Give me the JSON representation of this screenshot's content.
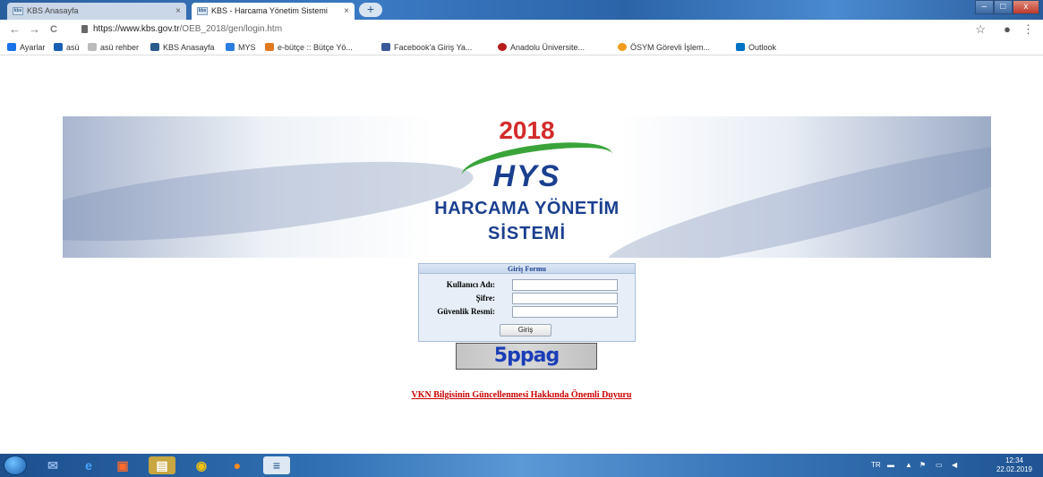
{
  "browser": {
    "tabs": [
      {
        "label": "KBS Anasayfa",
        "active": false
      },
      {
        "label": "KBS - Harcama Yönetim Sistemi",
        "active": true
      }
    ],
    "tab_close": "×",
    "new_tab": "+",
    "window_controls": {
      "minimize": "–",
      "maximize": "□",
      "close": "x"
    },
    "nav": {
      "back": "←",
      "forward": "→",
      "reload": "C"
    },
    "url_host": "https://www.kbs.gov.tr",
    "url_path": "/OEB_2018/gen/login.htm",
    "bookmarks": [
      {
        "label": "Ayarlar",
        "color": "#1a73e8"
      },
      {
        "label": "asü",
        "color": "#1a5fb4"
      },
      {
        "label": "asü rehber",
        "color": "#888888"
      },
      {
        "label": "KBS Anasayfa",
        "color": "#2a5a8c"
      },
      {
        "label": "MYS",
        "color": "#2a7de1"
      },
      {
        "label": "e-bütçe :: Bütçe Yö...",
        "color": "#e07a1f"
      },
      {
        "label": "Facebook'a Giriş Ya...",
        "color": "#3b5998"
      },
      {
        "label": "Anadolu Üniversite...",
        "color": "#b71c1c"
      },
      {
        "label": "ÖSYM Görevli İşlem...",
        "color": "#f29c1f"
      },
      {
        "label": "Outlook",
        "color": "#0072c6"
      }
    ]
  },
  "banner": {
    "year": "2018",
    "logo": "HYS",
    "title_line1": "HARCAMA YÖNETİM",
    "title_line2": "SİSTEMİ"
  },
  "login": {
    "title": "Giriş Formu",
    "username_label": "Kullanıcı Adı:",
    "password_label": "Şifre:",
    "captcha_label": "Güvenlik Resmi:",
    "username_value": "",
    "password_value": "",
    "captcha_value": "",
    "submit_label": "Giriş",
    "captcha_text": "5ppag"
  },
  "announcement": "VKN Bilgisinin Güncellenmesi Hakkında Önemli Duyuru",
  "taskbar": {
    "tray_lang": "TR",
    "time": "12:34",
    "date": "22.02.2019"
  }
}
